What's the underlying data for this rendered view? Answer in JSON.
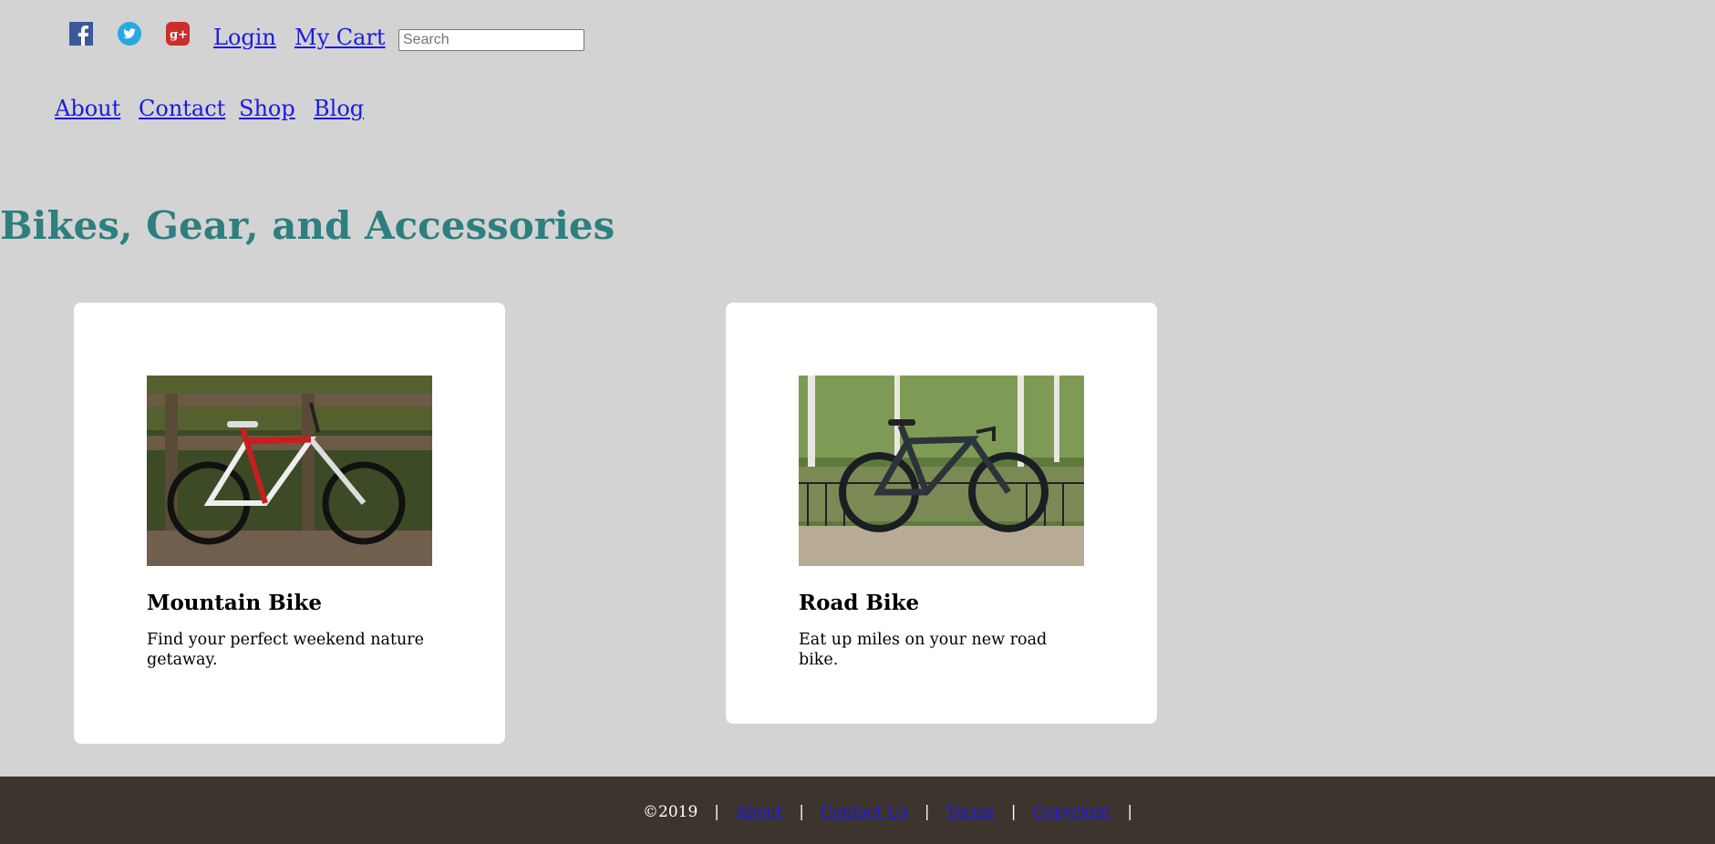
{
  "header": {
    "social": [
      "facebook-icon",
      "twitter-icon",
      "google-plus-icon"
    ],
    "login_label": "Login",
    "cart_label": "My Cart",
    "search_placeholder": "Search"
  },
  "nav": {
    "items": [
      "About",
      "Contact",
      "Shop",
      "Blog"
    ]
  },
  "page": {
    "heading": "Bikes, Gear, and Accessories",
    "heading_color": "#2e7f7f"
  },
  "cards": [
    {
      "title": "Mountain Bike",
      "description": "Find your perfect weekend nature getaway.",
      "image": "mountain-bike-photo"
    },
    {
      "title": "Road Bike",
      "description": "Eat up miles on your new road bike.",
      "image": "road-bike-photo"
    }
  ],
  "footer": {
    "copyright": "©2019",
    "links": [
      "About",
      "Contact Us",
      "Terms",
      "Copyright"
    ],
    "separator": "|",
    "background": "#3d342d"
  }
}
